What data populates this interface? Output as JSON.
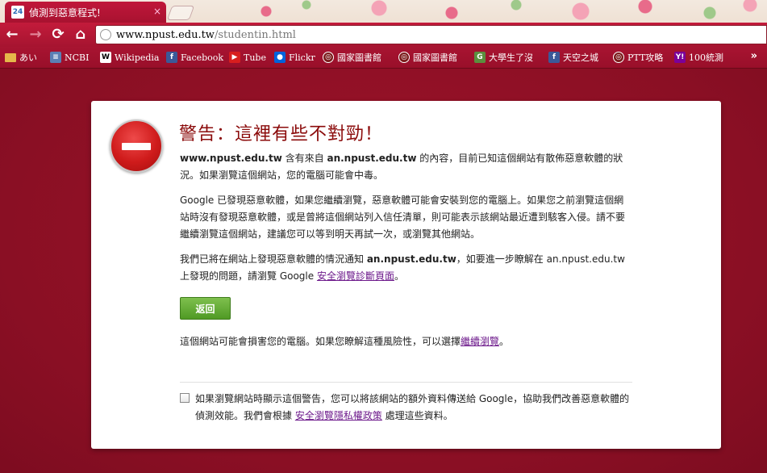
{
  "window": {
    "tab_title": "偵測到惡意程式!",
    "tab_close": "×"
  },
  "toolbar": {
    "back": "←",
    "forward": "→",
    "reload": "⟳",
    "home": "⌂",
    "url_host": "www.npust.edu.tw",
    "url_path": "/studentin.html"
  },
  "bookmarks": [
    {
      "label": "あい",
      "icon": "folder-icon",
      "color": "#e5b84a"
    },
    {
      "label": "NCBI",
      "icon": "ncbi-icon",
      "color": "#5a7fb5"
    },
    {
      "label": "Wikipedia",
      "icon": "wikipedia-icon",
      "color": "#ffffff"
    },
    {
      "label": "Facebook",
      "icon": "facebook-icon",
      "color": "#3b5998"
    },
    {
      "label": "Tube",
      "icon": "youtube-icon",
      "color": "#d81e1e"
    },
    {
      "label": "Flickr",
      "icon": "flickr-icon",
      "color": "#0063dc"
    },
    {
      "label": "國家圖書館",
      "icon": "globe-icon",
      "color": "#7a1b1b"
    },
    {
      "label": "國家圖書館",
      "icon": "globe-icon",
      "color": "#7a1b1b"
    },
    {
      "label": "大學生了沒",
      "icon": "page-icon",
      "color": "#5b8f3e"
    },
    {
      "label": "天空之城",
      "icon": "facebook-icon",
      "color": "#3b5998"
    },
    {
      "label": "PTT攻略",
      "icon": "globe-icon",
      "color": "#7a1b1b"
    },
    {
      "label": "100統測",
      "icon": "yahoo-icon",
      "color": "#7b0099"
    }
  ],
  "bookmarks_more": "»",
  "warning": {
    "title": "警告：這裡有些不對勁！",
    "p1_host": "www.npust.edu.tw",
    "p1_mid": " 含有來自 ",
    "p1_source": "an.npust.edu.tw",
    "p1_rest": " 的內容，目前已知這個網站有散佈惡意軟體的狀況。如果瀏覽這個網站，您的電腦可能會中毒。",
    "p2": "Google 已發現惡意軟體，如果您繼續瀏覽，惡意軟體可能會安裝到您的電腦上。如果您之前瀏覽這個網站時沒有發現惡意軟體，或是曾將這個網站列入信任清單，則可能表示該網站最近遭到駭客入侵。請不要繼續瀏覽這個網站，建議您可以等到明天再試一次，或瀏覽其他網站。",
    "p3_pre": "我們已將在網站上發現惡意軟體的情況通知 ",
    "p3_host": "an.npust.edu.tw",
    "p3_mid": "，如要進一步瞭解在 an.npust.edu.tw 上發現的問題，請瀏覽 Google ",
    "p3_link": "安全瀏覽診斷頁面",
    "p3_end": "。",
    "back_button": "返回",
    "p4_pre": "這個網站可能會損害您的電腦。如果您瞭解這種風險性，可以選擇",
    "p4_link": "繼續瀏覽",
    "p4_end": "。",
    "report_pre": "如果瀏覽網站時顯示這個警告，您可以將該網站的額外資料傳送給 Google，協助我們改善惡意軟體的偵測效能。我們會根據 ",
    "report_link": "安全瀏覽隱私權政策",
    "report_end": " 處理這些資料。"
  }
}
